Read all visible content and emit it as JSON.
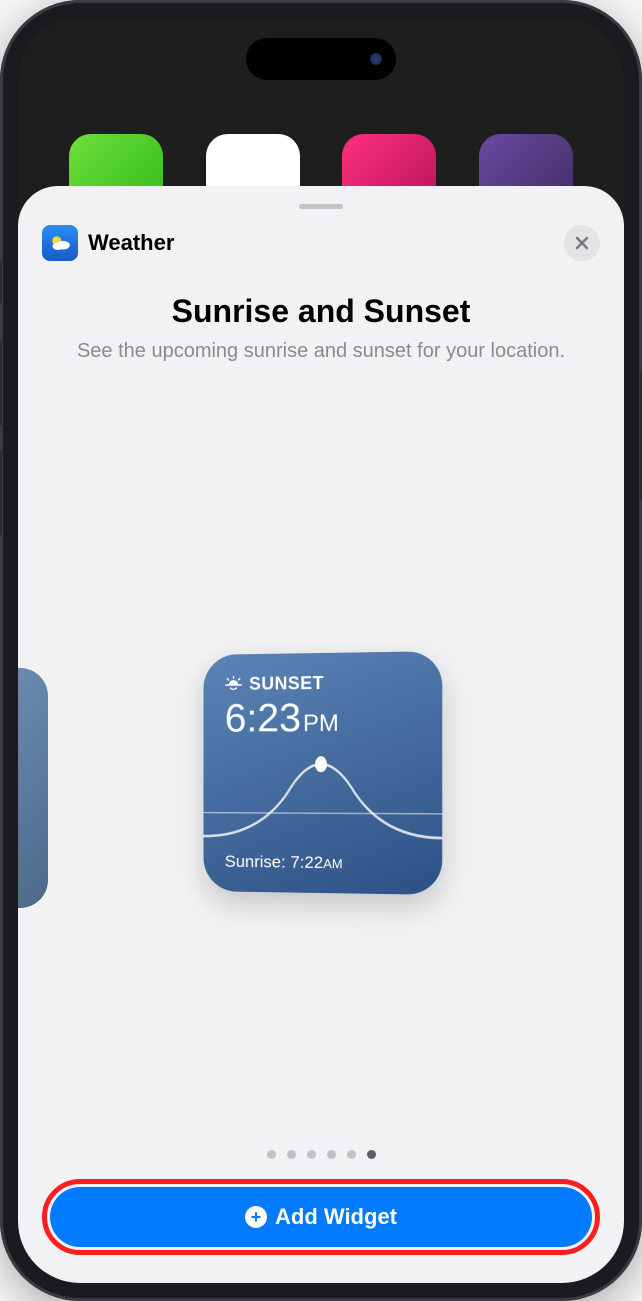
{
  "app": {
    "name": "Weather"
  },
  "widget": {
    "title": "Sunrise and Sunset",
    "description": "See the upcoming sunrise and sunset for your location.",
    "sunset_label": "SUNSET",
    "sunset_time": "6:23",
    "sunset_ampm": "PM",
    "sunrise_prefix": "Sunrise: ",
    "sunrise_time": "7:22",
    "sunrise_ampm": "AM"
  },
  "pager": {
    "count": 6,
    "active_index": 5
  },
  "actions": {
    "add_widget": "Add Widget"
  }
}
